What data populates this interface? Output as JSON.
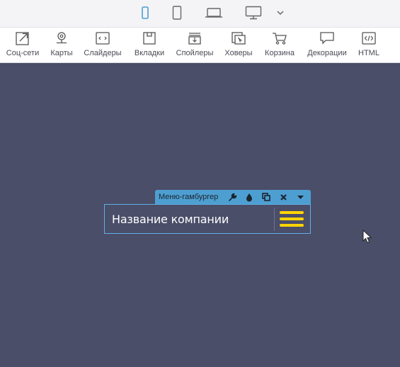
{
  "device_bar": {
    "devices": [
      {
        "name": "mobile-icon",
        "active": true
      },
      {
        "name": "tablet-icon",
        "active": false
      },
      {
        "name": "laptop-icon",
        "active": false
      },
      {
        "name": "desktop-icon",
        "active": false
      }
    ],
    "dropdown_icon": "chevron-down-icon"
  },
  "toolbar": {
    "items": [
      {
        "label": "Соц-сети",
        "icon": "share-icon"
      },
      {
        "label": "Карты",
        "icon": "map-pin-icon"
      },
      {
        "label": "Слайдеры",
        "icon": "slider-icon"
      },
      {
        "label": "Вкладки",
        "icon": "tabs-icon"
      },
      {
        "label": "Спойлеры",
        "icon": "spoiler-icon"
      },
      {
        "label": "Ховеры",
        "icon": "hover-icon"
      },
      {
        "label": "Корзина",
        "icon": "cart-icon"
      },
      {
        "label": "Декорации",
        "icon": "speech-bubble-icon"
      },
      {
        "label": "HTML",
        "icon": "code-icon"
      }
    ]
  },
  "widget": {
    "toolbar_title": "Меню-гамбургер",
    "company_name": "Название компании",
    "actions": [
      "wrench-icon",
      "drop-icon",
      "duplicate-icon",
      "close-icon",
      "caret-down-icon"
    ],
    "accent_color": "#ffd400",
    "selection_color": "#4e9fd1"
  },
  "colors": {
    "canvas": "#4a4e69",
    "active_device": "#4e9fd1"
  }
}
